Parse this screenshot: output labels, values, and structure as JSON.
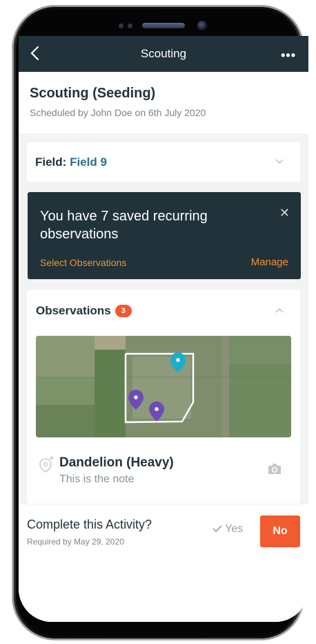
{
  "header": {
    "title": "Scouting",
    "back_icon": "chevron-left-icon",
    "more_label": "•••"
  },
  "activity": {
    "title": "Scouting (Seeding)",
    "subtitle": "Scheduled by John Doe on 6th July 2020"
  },
  "field": {
    "label": "Field:",
    "value": "Field 9"
  },
  "recurring": {
    "message": "You have 7 saved recurring observations",
    "close_label": "✕",
    "select_label": "Select Observations",
    "manage_label": "Manage"
  },
  "observations": {
    "title": "Observations",
    "count": "3",
    "items": [
      {
        "name": "Dandelion (Heavy)",
        "note": "This is the note"
      }
    ]
  },
  "completion": {
    "question": "Complete this Activity?",
    "required": "Required by May 29, 2020",
    "yes_label": "Yes",
    "no_label": "No"
  },
  "colors": {
    "header_bg": "#21323a",
    "accent_orange": "#f29132",
    "badge_red": "#ee5b2f",
    "field_teal": "#2c6f86",
    "pin_teal": "#1aaecd",
    "pin_purple": "#6f4bb8"
  }
}
